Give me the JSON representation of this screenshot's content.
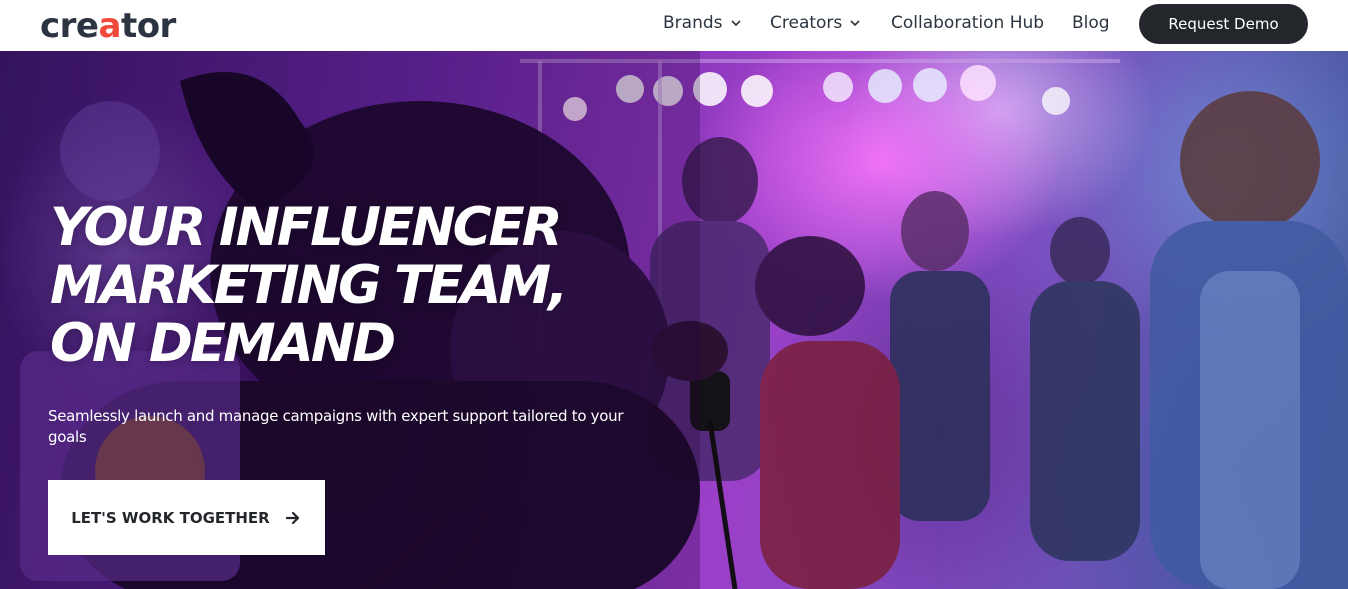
{
  "header": {
    "logo": {
      "pre": "cre",
      "accent": "a",
      "post": "tor"
    },
    "nav": [
      {
        "label": "Brands",
        "has_dropdown": true
      },
      {
        "label": "Creators",
        "has_dropdown": true
      },
      {
        "label": "Collaboration Hub",
        "has_dropdown": false
      },
      {
        "label": "Blog",
        "has_dropdown": false
      }
    ],
    "cta_label": "Request Demo",
    "cta_color": "#23262b"
  },
  "hero": {
    "title_lines": [
      "YOUR INFLUENCER",
      "MARKETING TEAM,",
      "ON DEMAND"
    ],
    "subtitle": "Seamlessly launch and manage campaigns with expert support tailored to your goals",
    "cta_label": "LET'S WORK TOGETHER",
    "cta_icon": "arrow-right-icon",
    "accent_colors": [
      "#9b3fc8",
      "#6a2aa6",
      "#3e5a9a"
    ]
  },
  "icons": {
    "dropdown": "chevron-down-icon",
    "cta": "arrow-right-icon"
  }
}
